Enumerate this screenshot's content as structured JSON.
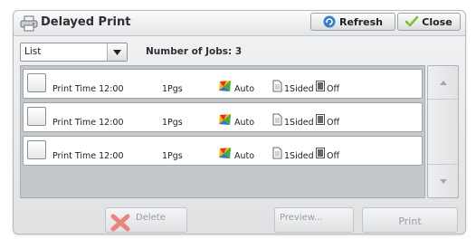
{
  "window": {
    "title": "Delayed Print",
    "refresh_label": "Refresh",
    "close_label": "Close"
  },
  "filter": {
    "selected": "List",
    "job_count_text": "Number of Jobs: 3"
  },
  "jobs": [
    {
      "print_time": "Print Time 12:00",
      "pages": "1Pgs",
      "color": "Auto",
      "sides": "1Sided",
      "staple": "Off"
    },
    {
      "print_time": "Print Time 12:00",
      "pages": "1Pgs",
      "color": "Auto",
      "sides": "1Sided",
      "staple": "Off"
    },
    {
      "print_time": "Print Time 12:00",
      "pages": "1Pgs",
      "color": "Auto",
      "sides": "1Sided",
      "staple": "Off"
    }
  ],
  "actions": {
    "delete_label": "Delete",
    "preview_label": "Preview...",
    "print_label": "Print"
  },
  "icons": {
    "title": "printer-icon",
    "refresh": "refresh-icon",
    "close": "checkmark-icon",
    "dropdown": "chevron-down-icon",
    "color": "color-mode-icon",
    "sides": "document-icon",
    "staple": "staple-icon",
    "delete": "x-icon",
    "scroll_up": "arrow-up-icon",
    "scroll_down": "arrow-down-icon"
  },
  "colors": {
    "refresh_icon": "#2f7fd1",
    "close_icon": "#7cc233",
    "delete_icon": "#e05a4e"
  }
}
